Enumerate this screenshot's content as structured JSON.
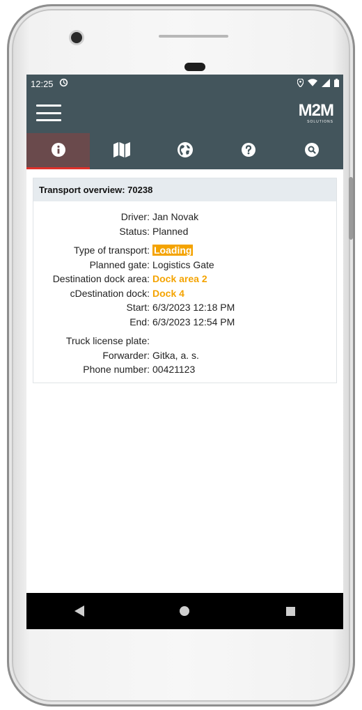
{
  "status_bar": {
    "time": "12:25",
    "sync_icon": "sync-icon",
    "icons": [
      "location-icon",
      "wifi-icon",
      "signal-icon",
      "battery-icon"
    ]
  },
  "app_bar": {
    "logo_main": "M2M",
    "logo_sub": "SOLUTIONS"
  },
  "tabs": [
    {
      "icon": "info-icon",
      "active": true
    },
    {
      "icon": "map-icon",
      "active": false
    },
    {
      "icon": "globe-icon",
      "active": false
    },
    {
      "icon": "help-icon",
      "active": false
    },
    {
      "icon": "search-icon",
      "active": false
    }
  ],
  "card": {
    "title": "Transport overview: 70238",
    "rows": [
      {
        "label": "Driver:",
        "value": "Jan Novak"
      },
      {
        "label": "Status:",
        "value": "Planned"
      },
      {
        "label": "Type of transport:",
        "value": "Loading"
      },
      {
        "label": "Planned gate:",
        "value": "Logistics Gate"
      },
      {
        "label": "Destination dock area:",
        "value": "Dock area 2"
      },
      {
        "label": "cDestination dock:",
        "value": "Dock 4"
      },
      {
        "label": "Start:",
        "value": "6/3/2023 12:18 PM"
      },
      {
        "label": "End:",
        "value": "6/3/2023 12:54 PM"
      },
      {
        "label": "Truck license plate:",
        "value": ""
      },
      {
        "label": "Forwarder:",
        "value": "Gitka, a. s."
      },
      {
        "label": "Phone number:",
        "value": "00421123"
      }
    ]
  },
  "colors": {
    "header": "#43555c",
    "active_tab": "#6a4a4c",
    "active_indicator": "#e0312b",
    "highlight": "#f4a300"
  },
  "nav": [
    "back-icon",
    "home-icon",
    "recents-icon"
  ]
}
